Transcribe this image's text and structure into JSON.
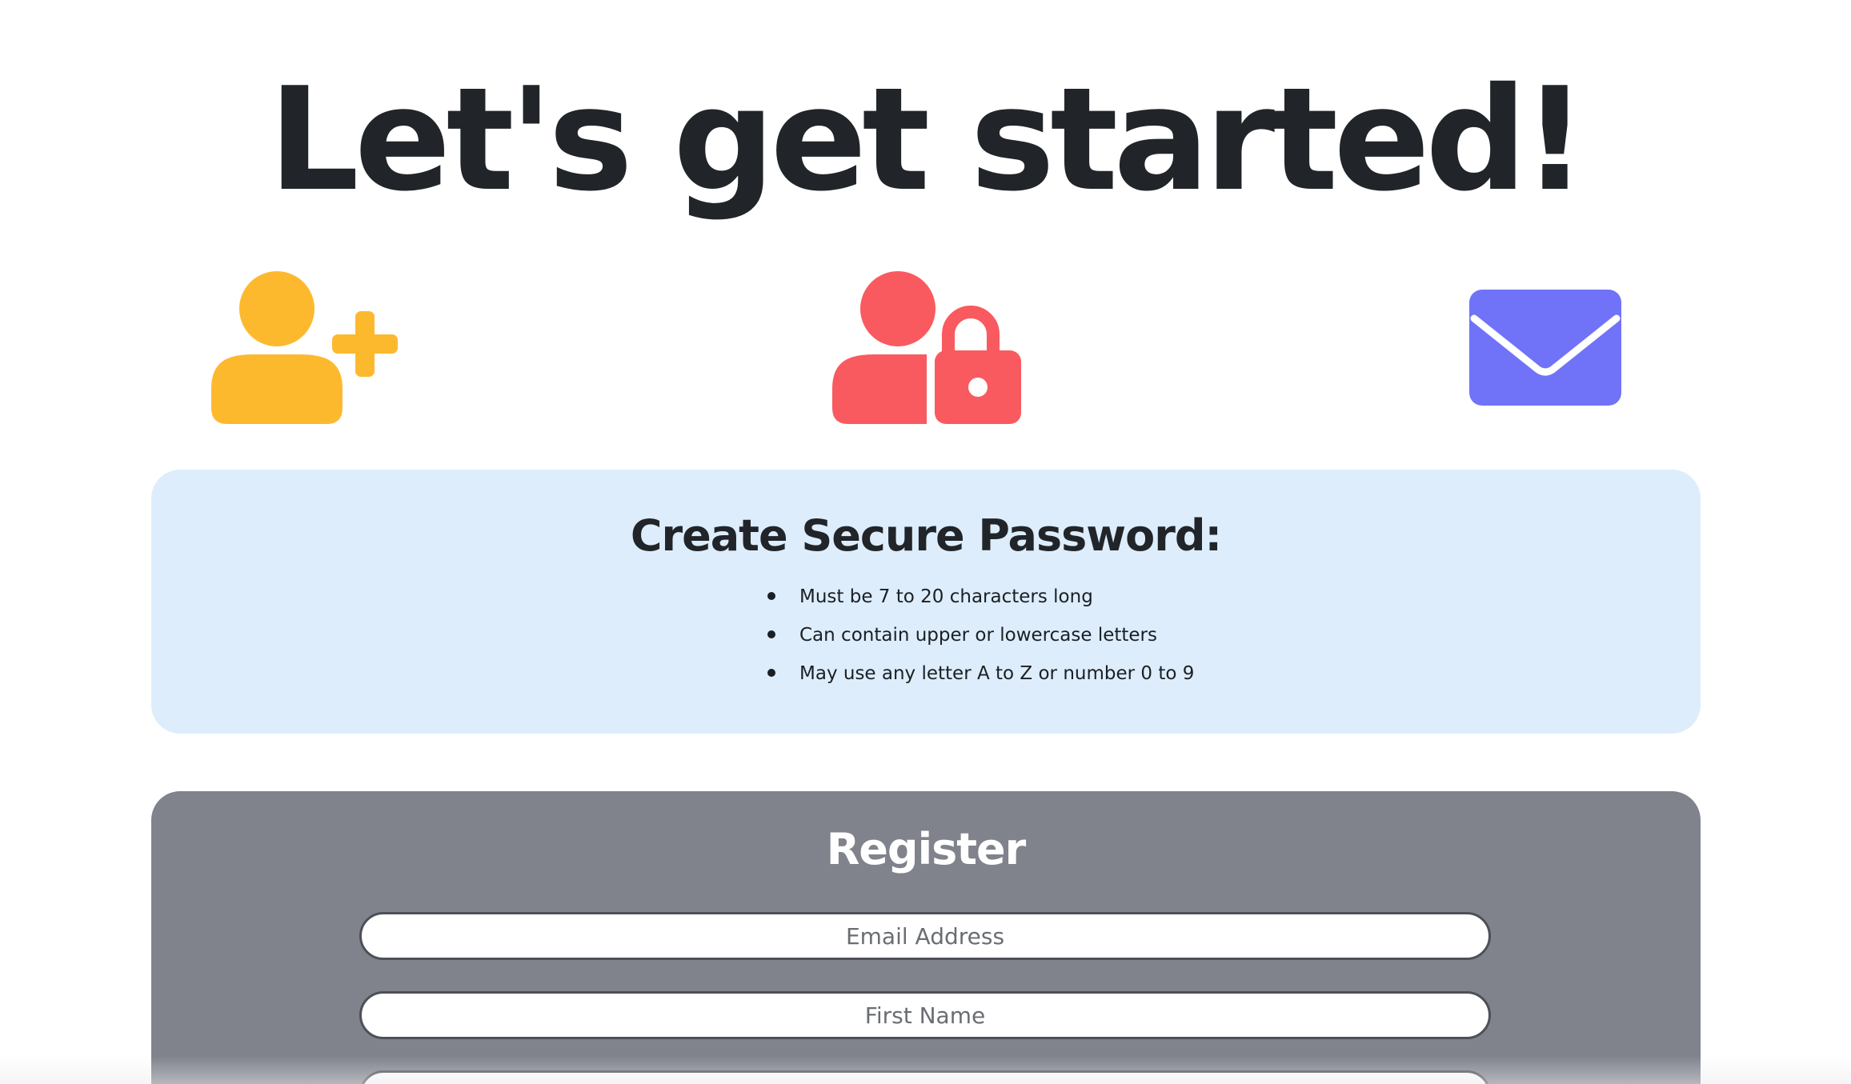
{
  "header": {
    "title": "Let's get started!"
  },
  "steps": [
    {
      "icon": "user-plus-icon",
      "color": "#FDB92E"
    },
    {
      "icon": "user-lock-icon",
      "color": "#F95A5F"
    },
    {
      "icon": "envelope-icon",
      "color": "#7073F8"
    }
  ],
  "password_info": {
    "heading": "Create Secure Password:",
    "rules": [
      "Must be 7 to 20 characters long",
      "Can contain upper or lowercase letters",
      "May use any letter A to Z or number 0 to 9"
    ],
    "background": "#DDEDFB"
  },
  "register": {
    "heading": "Register",
    "background": "#80838C",
    "email_placeholder": "Email Address",
    "first_name_placeholder": "First Name"
  }
}
